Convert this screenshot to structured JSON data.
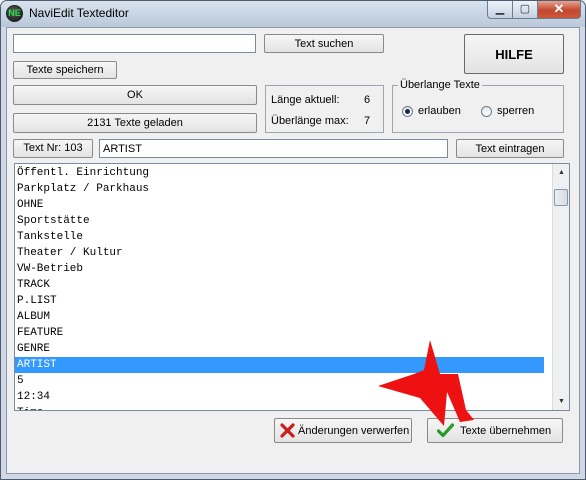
{
  "window": {
    "title": "NaviEdit Texteditor",
    "icon_name": "app-logo-icon",
    "icon_text": "NE",
    "min_glyph": "▁",
    "max_glyph": "▢",
    "close_glyph": "✕"
  },
  "search": {
    "value": "",
    "button_label": "Text suchen"
  },
  "help_button_label": "HILFE",
  "save_button_label": "Texte speichern",
  "ok_button_label": "OK",
  "loaded_status": "2131 Texte geladen",
  "length": {
    "current_label": "Länge aktuell:",
    "current_value": "6",
    "max_label": "Überlänge max:",
    "max_value": "7"
  },
  "overlength_group": {
    "title": "Überlange Texte",
    "options": [
      {
        "label": "erlauben",
        "checked": true
      },
      {
        "label": "sperren",
        "checked": false
      }
    ]
  },
  "text_number_label": "Text Nr: 103",
  "text_edit_value": "ARTIST",
  "insert_button_label": "Text eintragen",
  "list": {
    "items": [
      "Öffentl. Einrichtung",
      "Parkplatz / Parkhaus",
      "OHNE",
      "Sportstätte",
      "Tankstelle",
      "Theater / Kultur",
      "VW-Betrieb",
      "TRACK",
      "P.LIST",
      "ALBUM",
      "FEATURE",
      "GENRE",
      "ARTIST",
      "5",
      "12:34",
      "Time"
    ],
    "selected_index": 12,
    "scroll_up_glyph": "▲",
    "scroll_down_glyph": "▼"
  },
  "discard_button_label": "Änderungen verwerfen",
  "apply_button_label": "Texte übernehmen",
  "colors": {
    "selection": "#3399ff",
    "discard_icon": "#c8201b",
    "apply_icon": "#2a9a2a",
    "arrow": "#ee1111"
  }
}
